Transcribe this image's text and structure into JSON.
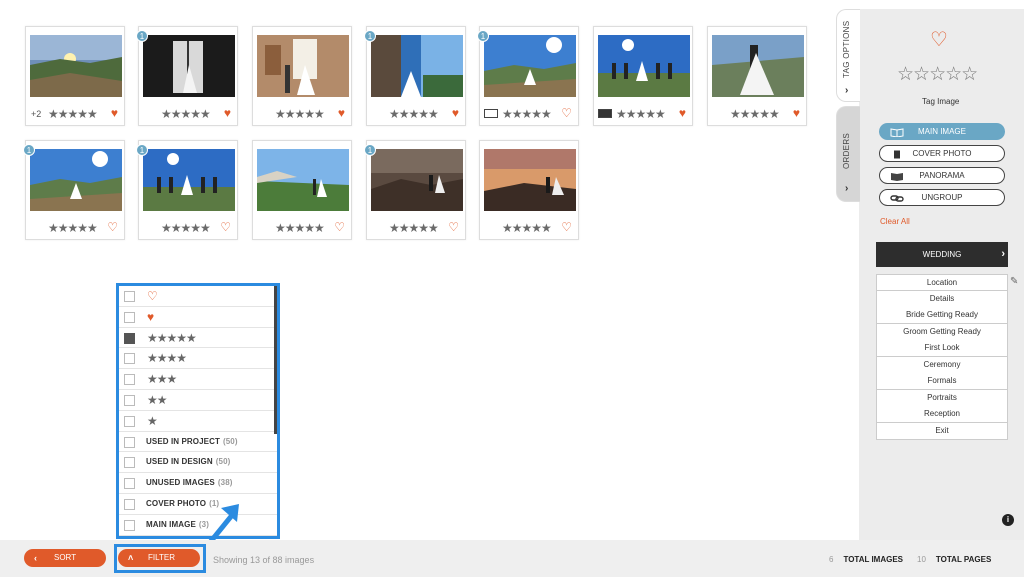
{
  "thumbnails": [
    {
      "badge": "",
      "plus": "+2",
      "stars": "★★★★★",
      "heart": "♥",
      "heart_filled": true,
      "type_icon": "",
      "scene": "sunset-mountain"
    },
    {
      "badge": "1",
      "plus": "",
      "stars": "★★★★★",
      "heart": "♥",
      "heart_filled": true,
      "type_icon": "",
      "scene": "bw-window"
    },
    {
      "badge": "",
      "plus": "",
      "stars": "★★★★★",
      "heart": "♥",
      "heart_filled": true,
      "type_icon": "",
      "scene": "room"
    },
    {
      "badge": "1",
      "plus": "",
      "stars": "★★★★★",
      "heart": "♥",
      "heart_filled": true,
      "type_icon": "",
      "scene": "window-sky"
    },
    {
      "badge": "1",
      "plus": "",
      "stars": "★★★★★",
      "heart": "♡",
      "heart_filled": false,
      "type_icon": "panorama-light",
      "scene": "mountain-sky"
    },
    {
      "badge": "",
      "plus": "",
      "stars": "★★★★★",
      "heart": "♥",
      "heart_filled": true,
      "type_icon": "panorama-dark",
      "scene": "group-sky"
    },
    {
      "badge": "",
      "plus": "",
      "stars": "★★★★★",
      "heart": "♥",
      "heart_filled": true,
      "type_icon": "",
      "scene": "couple-hill"
    },
    {
      "badge": "1",
      "plus": "",
      "stars": "★★★★★",
      "heart": "♡",
      "heart_filled": false,
      "type_icon": "",
      "scene": "mountain-sky"
    },
    {
      "badge": "1",
      "plus": "",
      "stars": "★★★★★",
      "heart": "♡",
      "heart_filled": false,
      "type_icon": "",
      "scene": "group-sky"
    },
    {
      "badge": "",
      "plus": "",
      "stars": "★★★★★",
      "heart": "♡",
      "heart_filled": false,
      "type_icon": "",
      "scene": "valley"
    },
    {
      "badge": "1",
      "plus": "",
      "stars": "★★★★★",
      "heart": "♡",
      "heart_filled": false,
      "type_icon": "",
      "scene": "rocks-dusk"
    },
    {
      "badge": "",
      "plus": "",
      "stars": "★★★★★",
      "heart": "♡",
      "heart_filled": false,
      "type_icon": "",
      "scene": "rocks-sunset"
    }
  ],
  "filter": {
    "rows": [
      {
        "kind": "icon",
        "value": "♡",
        "checked": false,
        "heart": true
      },
      {
        "kind": "icon",
        "value": "♥",
        "checked": false,
        "heart": true
      },
      {
        "kind": "icon",
        "value": "★★★★★",
        "checked": true,
        "heart": false
      },
      {
        "kind": "icon",
        "value": "★★★★",
        "checked": false,
        "heart": false
      },
      {
        "kind": "icon",
        "value": "★★★",
        "checked": false,
        "heart": false
      },
      {
        "kind": "icon",
        "value": "★★",
        "checked": false,
        "heart": false
      },
      {
        "kind": "icon",
        "value": "★",
        "checked": false,
        "heart": false
      },
      {
        "kind": "text",
        "label": "USED IN PROJECT",
        "count": "(50)",
        "checked": false
      },
      {
        "kind": "text",
        "label": "USED IN DESIGN",
        "count": "(50)",
        "checked": false
      },
      {
        "kind": "text",
        "label": "UNUSED IMAGES",
        "count": "(38)",
        "checked": false
      },
      {
        "kind": "text",
        "label": "COVER PHOTO",
        "count": "(1)",
        "checked": false
      },
      {
        "kind": "text",
        "label": "MAIN IMAGE",
        "count": "(3)",
        "checked": false
      }
    ]
  },
  "right_panel": {
    "tab_tag_options": "TAG OPTIONS",
    "tab_orders": "ORDERS",
    "chevron": "›",
    "heart": "♡",
    "stars": "☆☆☆☆☆",
    "tag_image": "Tag Image",
    "buttons": [
      {
        "label": "MAIN IMAGE",
        "icon": "main-image-icon",
        "active": true
      },
      {
        "label": "COVER PHOTO",
        "icon": "cover-photo-icon",
        "active": false
      },
      {
        "label": "PANORAMA",
        "icon": "panorama-icon",
        "active": false
      },
      {
        "label": "UNGROUP",
        "icon": "link-icon",
        "active": false
      }
    ],
    "clear_all": "Clear All",
    "wedding": "WEDDING",
    "wedding_chevron": "›",
    "pencil": "✎",
    "categories": [
      "Location",
      "Details",
      "Bride Getting Ready",
      "Groom Getting Ready",
      "First Look",
      "Ceremony",
      "Formals",
      "Portraits",
      "Reception",
      "Exit"
    ],
    "info": "i"
  },
  "bottom": {
    "sort_chevron": "‹",
    "sort_label": "SORT",
    "filter_chevron": "˄",
    "filter_label": "FILTER",
    "showing": "Showing 13 of 88 images",
    "total_images_value": "6",
    "total_images_label": "TOTAL IMAGES",
    "total_pages_value": "10",
    "total_pages_label": "TOTAL PAGES"
  },
  "colors": {
    "accent": "#e05a2a",
    "highlight": "#2b8be0",
    "active_button": "#6aa7c5",
    "wedding_bar": "#2d2d2d"
  }
}
